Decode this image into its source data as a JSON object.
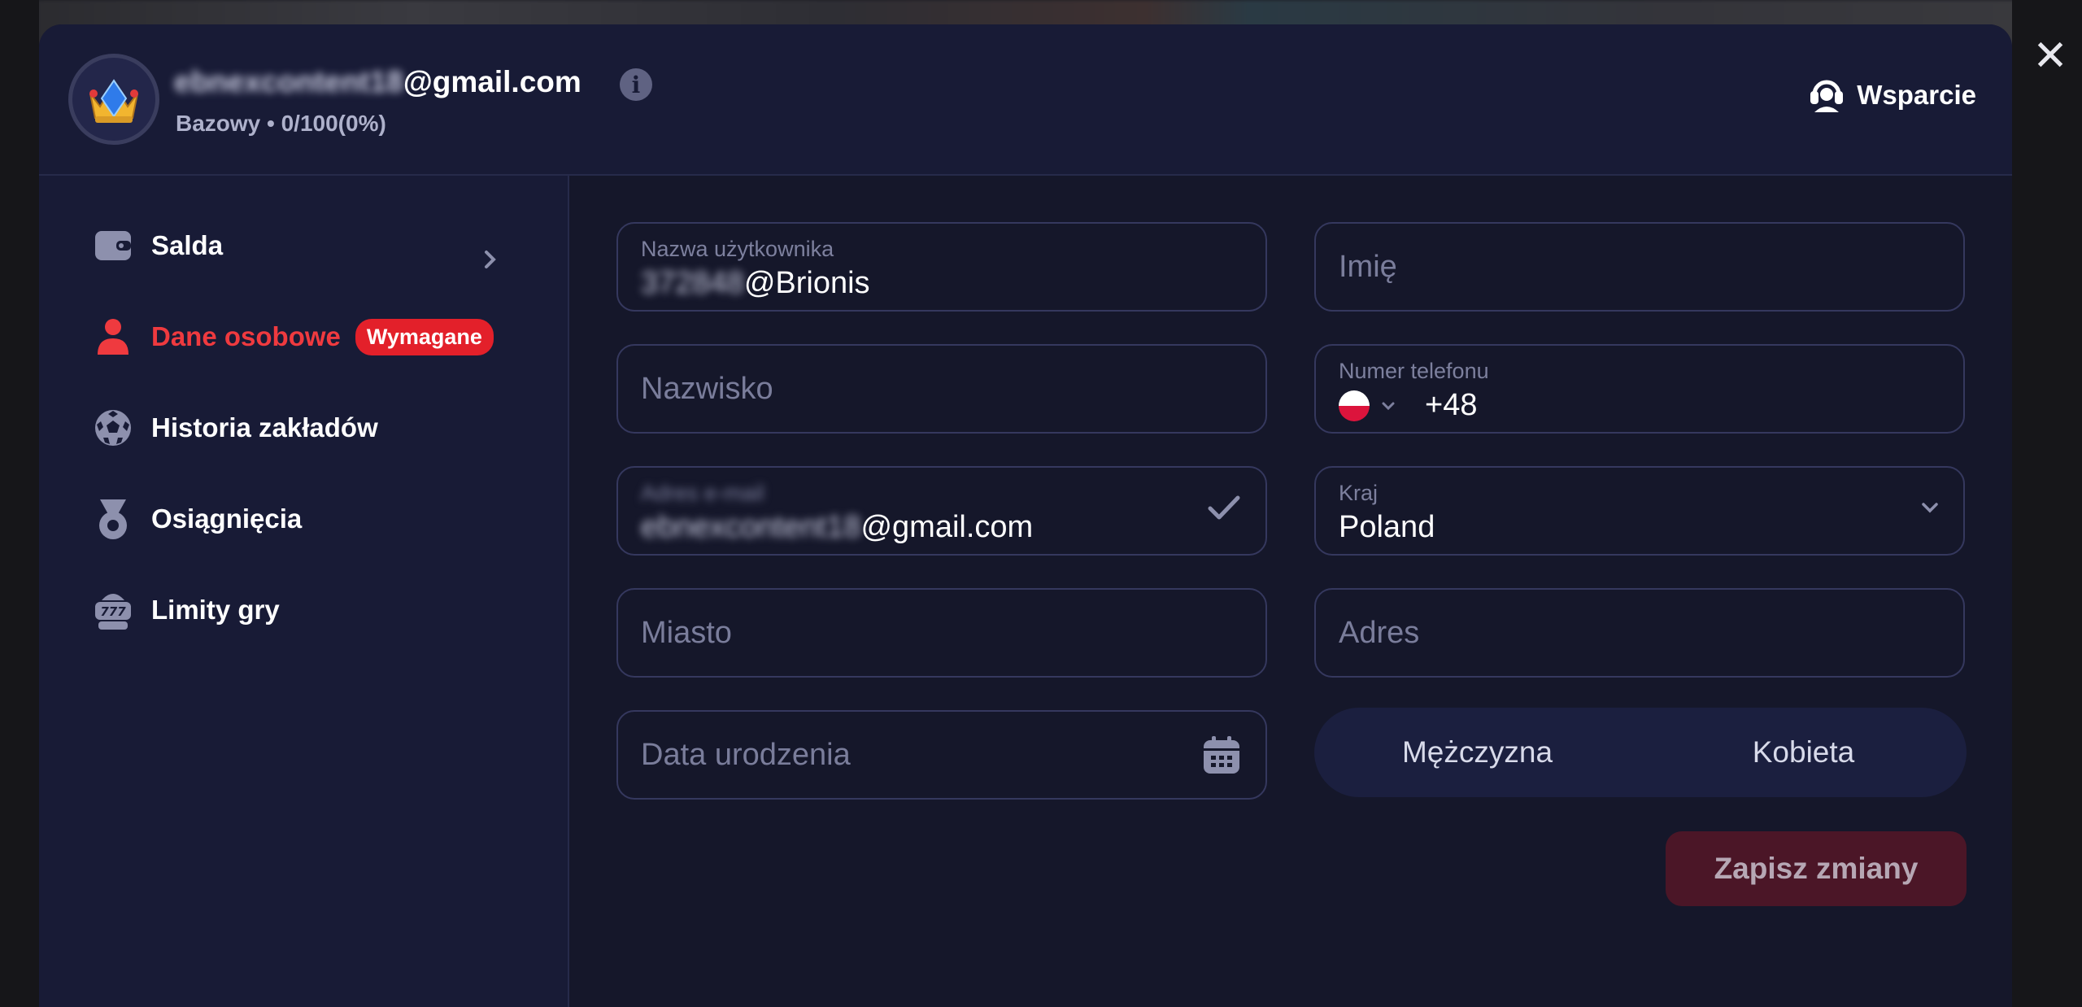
{
  "header": {
    "email_blurred": "ebnexcontent18",
    "email_domain": "@gmail.com",
    "level_text": "Bazowy • 0/100(0%)",
    "info_icon": "info-icon",
    "support_label": "Wsparcie",
    "support_icon": "headset-icon"
  },
  "close_icon": "✕",
  "sidebar": {
    "items": [
      {
        "label": "Salda",
        "icon": "wallet-icon",
        "active": false
      },
      {
        "label": "Dane osobowe",
        "icon": "person-icon",
        "active": true,
        "badge": "Wymagane"
      },
      {
        "label": "Historia zakładów",
        "icon": "soccer-ball-icon",
        "active": false
      },
      {
        "label": "Osiągnięcia",
        "icon": "medal-icon",
        "active": false
      },
      {
        "label": "Limity gry",
        "icon": "slot-machine-icon",
        "active": false
      }
    ]
  },
  "form": {
    "username": {
      "label": "Nazwa użytkownika",
      "value_blurred": "372848",
      "value": "@Brionis"
    },
    "first_name": {
      "placeholder": "Imię"
    },
    "last_name": {
      "placeholder": "Nazwisko"
    },
    "phone": {
      "label": "Numer telefonu",
      "prefix": "+48"
    },
    "email": {
      "label_blurred": "Adres e-mail",
      "value_blurred": "ebnexcontent18",
      "value": "@gmail.com"
    },
    "country": {
      "label": "Kraj",
      "value": "Poland"
    },
    "city": {
      "placeholder": "Miasto"
    },
    "address": {
      "placeholder": "Adres"
    },
    "birthdate": {
      "placeholder": "Data urodzenia"
    },
    "gender": {
      "male": "Mężczyzna",
      "female": "Kobieta"
    },
    "save_label": "Zapisz zmiany"
  },
  "colors": {
    "accent_red": "#ef3a3f",
    "badge_red": "#e3202a",
    "panel": "#181b36",
    "content": "#15172a",
    "save_button": "#4b1627"
  }
}
